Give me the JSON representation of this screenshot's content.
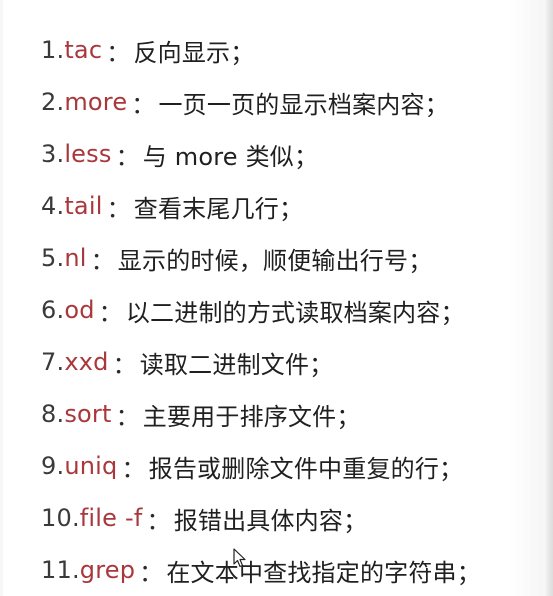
{
  "slide": {
    "items": [
      {
        "num": "1.",
        "cmd": "tac",
        "sep": "：",
        "desc": "反向显示；"
      },
      {
        "num": "2.",
        "cmd": "more",
        "sep": "：",
        "desc": "一页一页的显示档案内容；"
      },
      {
        "num": "3.",
        "cmd": "less",
        "sep": "：",
        "desc": "与 more 类似；"
      },
      {
        "num": "4.",
        "cmd": "tail",
        "sep": "：",
        "desc": "查看末尾几行；"
      },
      {
        "num": "5.",
        "cmd": "nl",
        "sep": "：",
        "desc": "显示的时候，顺便输出行号；"
      },
      {
        "num": "6. ",
        "cmd": "od",
        "sep": "：",
        "desc": "以二进制的方式读取档案内容；"
      },
      {
        "num": "7. ",
        "cmd": "xxd",
        "sep": "：",
        "desc": "读取二进制文件；"
      },
      {
        "num": "8. ",
        "cmd": "sort",
        "sep": "：",
        "desc": "主要用于排序文件；"
      },
      {
        "num": "9. ",
        "cmd": "uniq",
        "sep": "：",
        "desc": "报告或删除文件中重复的行；"
      },
      {
        "num": "10. ",
        "cmd": "file -f",
        "sep": "：",
        "desc": "报错出具体内容；"
      },
      {
        "num": "11. ",
        "cmd": "grep",
        "sep": "：",
        "desc": "在文本中查找指定的字符串；"
      }
    ]
  },
  "icons": {
    "cursor": "mouse-pointer-icon"
  }
}
